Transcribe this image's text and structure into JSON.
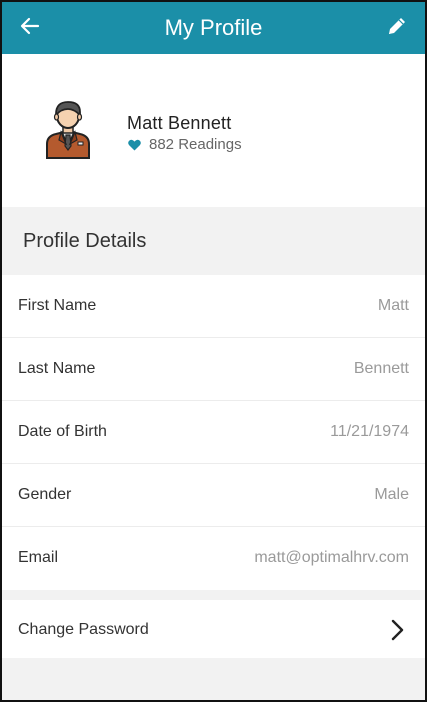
{
  "app_bar": {
    "title": "My Profile",
    "back_icon": "arrow-left-icon",
    "edit_icon": "pencil-icon",
    "background_color": "#1b8fa8"
  },
  "profile": {
    "name": "Matt Bennett",
    "readings_text": "882 Readings",
    "avatar_icon": "businessman-avatar-icon",
    "heart_icon": "heart-icon",
    "heart_color": "#1b8fa8"
  },
  "section": {
    "title": "Profile Details"
  },
  "fields": [
    {
      "label": "First Name",
      "value": "Matt"
    },
    {
      "label": "Last Name",
      "value": "Bennett"
    },
    {
      "label": "Date of Birth",
      "value": "11/21/1974"
    },
    {
      "label": "Gender",
      "value": "Male"
    },
    {
      "label": "Email",
      "value": "matt@optimalhrv.com"
    }
  ],
  "actions": {
    "change_password_label": "Change Password",
    "chevron_icon": "chevron-right-icon"
  }
}
